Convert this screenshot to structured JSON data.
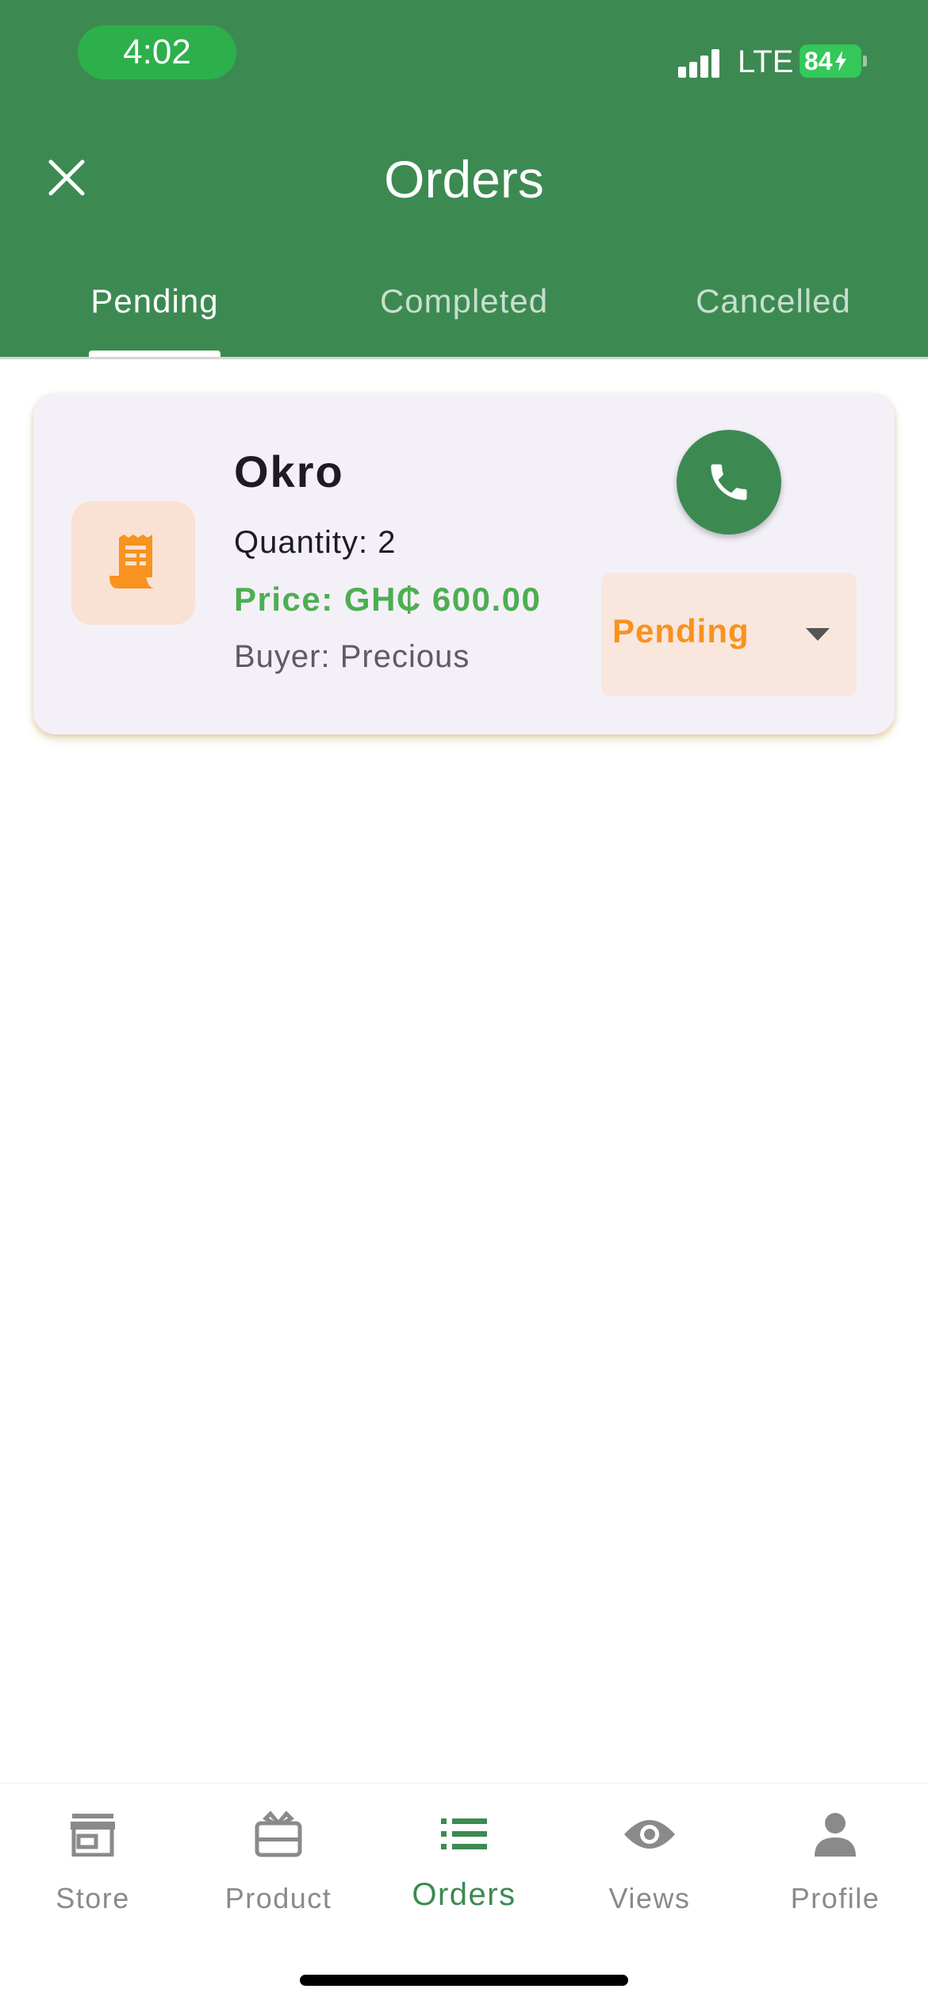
{
  "status_bar": {
    "time": "4:02",
    "network": "LTE",
    "battery": "84"
  },
  "header": {
    "title": "Orders",
    "close_icon": "close-icon"
  },
  "tabs": [
    {
      "label": "Pending",
      "active": true
    },
    {
      "label": "Completed",
      "active": false
    },
    {
      "label": "Cancelled",
      "active": false
    }
  ],
  "orders": [
    {
      "icon": "receipt-icon",
      "product": "Okro",
      "quantity": "Quantity: 2",
      "price": "Price: GH₵ 600.00",
      "buyer": "Buyer: Precious",
      "status": "Pending",
      "call_icon": "phone-icon"
    }
  ],
  "bottom_nav": [
    {
      "label": "Store",
      "icon": "store-icon",
      "active": false
    },
    {
      "label": "Product",
      "icon": "gift-card-icon",
      "active": false
    },
    {
      "label": "Orders",
      "icon": "list-icon",
      "active": true
    },
    {
      "label": "Views",
      "icon": "eye-icon",
      "active": false
    },
    {
      "label": "Profile",
      "icon": "person-icon",
      "active": false
    }
  ],
  "colors": {
    "primary": "#3c8a52",
    "price": "#4caf50",
    "status_pending": "#f7931e",
    "card_background": "#f4f0f8"
  }
}
